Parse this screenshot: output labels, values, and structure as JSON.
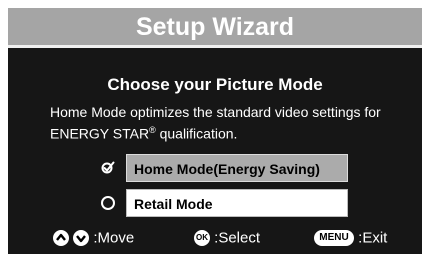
{
  "header": {
    "title": "Setup Wizard"
  },
  "content": {
    "heading": "Choose your Picture Mode",
    "description_line1": "Home Mode optimizes the standard video settings for",
    "description_line2_prefix": "ENERGY STAR",
    "description_registered": "®",
    "description_line2_suffix": " qualification."
  },
  "options": [
    {
      "label": "Home  Mode(Energy Saving)",
      "selected": true
    },
    {
      "label": "Retail Mode",
      "selected": false
    }
  ],
  "footer": {
    "move_label": ":Move",
    "ok_button": "OK",
    "select_label": ":Select",
    "menu_button": "MENU",
    "exit_label": ":Exit"
  },
  "colors": {
    "background": "#161616",
    "title_bar": "#a5a5a5",
    "highlight": "#ababab",
    "text": "#ffffff"
  }
}
